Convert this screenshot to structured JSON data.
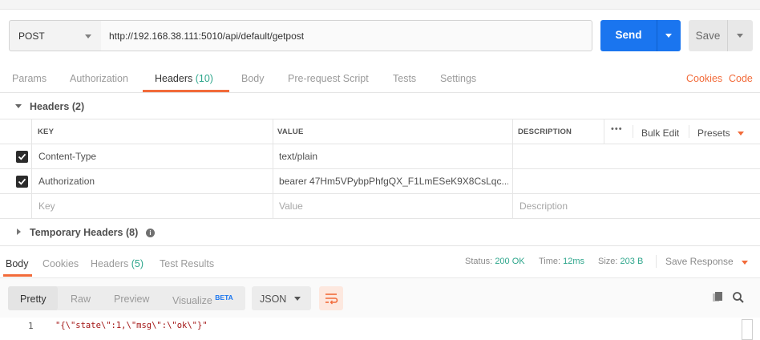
{
  "request": {
    "method": "POST",
    "url": "http://192.168.38.111:5010/api/default/getpost",
    "send_label": "Send",
    "save_label": "Save"
  },
  "tabs": [
    {
      "label": "Params",
      "count": ""
    },
    {
      "label": "Authorization",
      "count": ""
    },
    {
      "label": "Headers",
      "count": "(10)"
    },
    {
      "label": "Body",
      "count": ""
    },
    {
      "label": "Pre-request Script",
      "count": ""
    },
    {
      "label": "Tests",
      "count": ""
    },
    {
      "label": "Settings",
      "count": ""
    }
  ],
  "active_tab": "Headers",
  "tab_links": {
    "cookies": "Cookies",
    "code": "Code"
  },
  "headers_section": {
    "title": "Headers",
    "count": "(2)",
    "columns": {
      "key": "KEY",
      "value": "VALUE",
      "description": "DESCRIPTION"
    },
    "bulk_edit": "Bulk Edit",
    "presets": "Presets",
    "more": "•••",
    "rows": [
      {
        "checked": true,
        "key": "Content-Type",
        "value": "text/plain",
        "description": ""
      },
      {
        "checked": true,
        "key": "Authorization",
        "value": "bearer 47Hm5VPybpPhfgQX_F1LmESeK9X8CsLqc...",
        "description": ""
      }
    ],
    "placeholder": {
      "key": "Key",
      "value": "Value",
      "description": "Description"
    }
  },
  "temporary_headers": {
    "title": "Temporary Headers",
    "count": "(8)",
    "info_icon": "info-icon"
  },
  "response": {
    "tabs": [
      {
        "label": "Body",
        "count": ""
      },
      {
        "label": "Cookies",
        "count": ""
      },
      {
        "label": "Headers",
        "count": "(5)"
      },
      {
        "label": "Test Results",
        "count": ""
      }
    ],
    "status_label": "Status:",
    "status_value": "200 OK",
    "time_label": "Time:",
    "time_value": "12ms",
    "size_label": "Size:",
    "size_value": "203 B",
    "save_response": "Save Response",
    "view_modes": [
      "Pretty",
      "Raw",
      "Preview",
      "Visualize"
    ],
    "beta": "BETA",
    "active_view": "Pretty",
    "format": "JSON",
    "line_number": "1",
    "body_line": "\"{\\\"state\\\":1,\\\"msg\\\":\\\"ok\\\"}\""
  },
  "colors": {
    "accent": "#f26b3a",
    "send": "#1a75ef",
    "status_ok": "#2ea68c"
  }
}
